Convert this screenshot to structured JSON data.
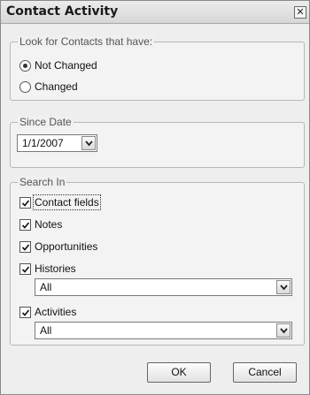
{
  "dialog": {
    "title": "Contact Activity",
    "close_glyph": "✕"
  },
  "look_for": {
    "legend": "Look for Contacts that have:",
    "options": [
      {
        "label": "Not Changed",
        "selected": true
      },
      {
        "label": "Changed",
        "selected": false
      }
    ]
  },
  "since_date": {
    "legend": "Since Date",
    "value": "1/1/2007"
  },
  "search_in": {
    "legend": "Search In",
    "contact_fields": {
      "label": "Contact fields",
      "checked": true
    },
    "notes": {
      "label": "Notes",
      "checked": true
    },
    "opportunities": {
      "label": "Opportunities",
      "checked": true
    },
    "histories": {
      "label": "Histories",
      "checked": true,
      "filter": "All"
    },
    "activities": {
      "label": "Activities",
      "checked": true,
      "filter": "All"
    }
  },
  "buttons": {
    "ok": "OK",
    "cancel": "Cancel"
  }
}
